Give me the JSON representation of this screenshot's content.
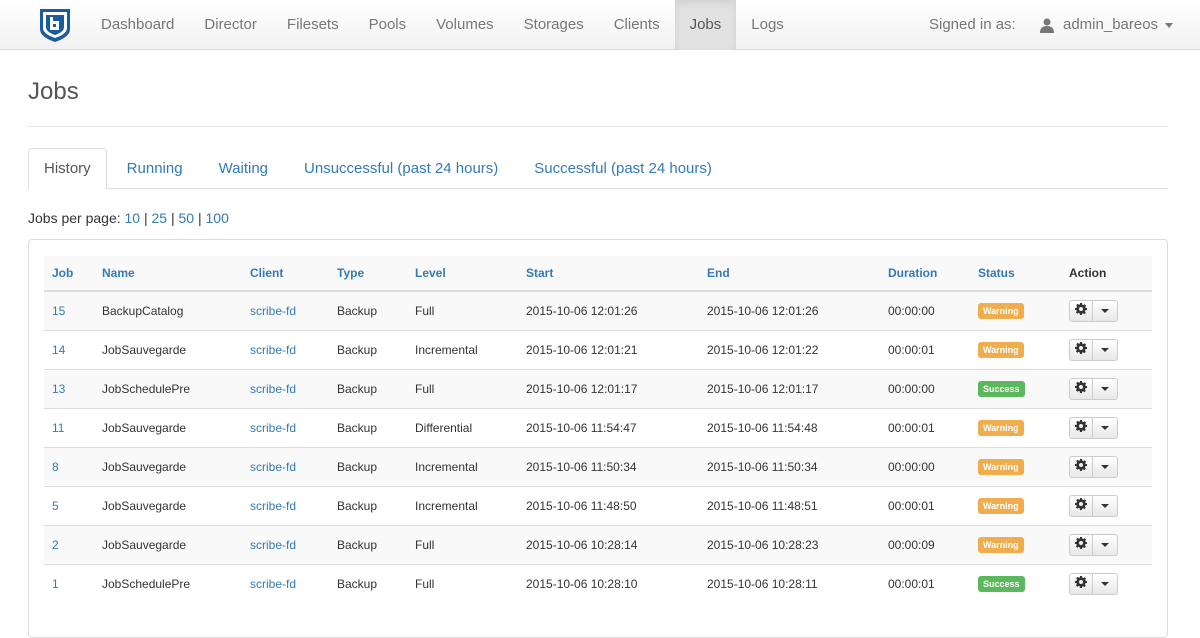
{
  "navbar": {
    "items": [
      "Dashboard",
      "Director",
      "Filesets",
      "Pools",
      "Volumes",
      "Storages",
      "Clients",
      "Jobs",
      "Logs"
    ],
    "active_index": 7,
    "signed_in_label": "Signed in as:",
    "username": "admin_bareos"
  },
  "page": {
    "title": "Jobs"
  },
  "tabs": {
    "items": [
      "History",
      "Running",
      "Waiting",
      "Unsuccessful (past 24 hours)",
      "Successful (past 24 hours)"
    ],
    "active_index": 0
  },
  "per_page": {
    "label": "Jobs per page:",
    "options": [
      "10",
      "25",
      "50",
      "100"
    ]
  },
  "table": {
    "columns": [
      "Job",
      "Name",
      "Client",
      "Type",
      "Level",
      "Start",
      "End",
      "Duration",
      "Status",
      "Action"
    ],
    "rows": [
      {
        "job": "15",
        "name": "BackupCatalog",
        "client": "scribe-fd",
        "type": "Backup",
        "level": "Full",
        "start": "2015-10-06 12:01:26",
        "end": "2015-10-06 12:01:26",
        "duration": "00:00:00",
        "status": "Warning"
      },
      {
        "job": "14",
        "name": "JobSauvegarde",
        "client": "scribe-fd",
        "type": "Backup",
        "level": "Incremental",
        "start": "2015-10-06 12:01:21",
        "end": "2015-10-06 12:01:22",
        "duration": "00:00:01",
        "status": "Warning"
      },
      {
        "job": "13",
        "name": "JobSchedulePre",
        "client": "scribe-fd",
        "type": "Backup",
        "level": "Full",
        "start": "2015-10-06 12:01:17",
        "end": "2015-10-06 12:01:17",
        "duration": "00:00:00",
        "status": "Success"
      },
      {
        "job": "11",
        "name": "JobSauvegarde",
        "client": "scribe-fd",
        "type": "Backup",
        "level": "Differential",
        "start": "2015-10-06 11:54:47",
        "end": "2015-10-06 11:54:48",
        "duration": "00:00:01",
        "status": "Warning"
      },
      {
        "job": "8",
        "name": "JobSauvegarde",
        "client": "scribe-fd",
        "type": "Backup",
        "level": "Incremental",
        "start": "2015-10-06 11:50:34",
        "end": "2015-10-06 11:50:34",
        "duration": "00:00:00",
        "status": "Warning"
      },
      {
        "job": "5",
        "name": "JobSauvegarde",
        "client": "scribe-fd",
        "type": "Backup",
        "level": "Incremental",
        "start": "2015-10-06 11:48:50",
        "end": "2015-10-06 11:48:51",
        "duration": "00:00:01",
        "status": "Warning"
      },
      {
        "job": "2",
        "name": "JobSauvegarde",
        "client": "scribe-fd",
        "type": "Backup",
        "level": "Full",
        "start": "2015-10-06 10:28:14",
        "end": "2015-10-06 10:28:23",
        "duration": "00:00:09",
        "status": "Warning"
      },
      {
        "job": "1",
        "name": "JobSchedulePre",
        "client": "scribe-fd",
        "type": "Backup",
        "level": "Full",
        "start": "2015-10-06 10:28:10",
        "end": "2015-10-06 10:28:11",
        "duration": "00:00:01",
        "status": "Success"
      }
    ]
  },
  "colors": {
    "link": "#337ab7",
    "warning": "#f0ad4e",
    "success": "#5cb85c",
    "logo": "#1a5d9e"
  },
  "icons": {
    "logo": "bareos-logo",
    "user": "user-icon",
    "gear": "gear-icon",
    "dropdown": "caret-down-icon"
  }
}
